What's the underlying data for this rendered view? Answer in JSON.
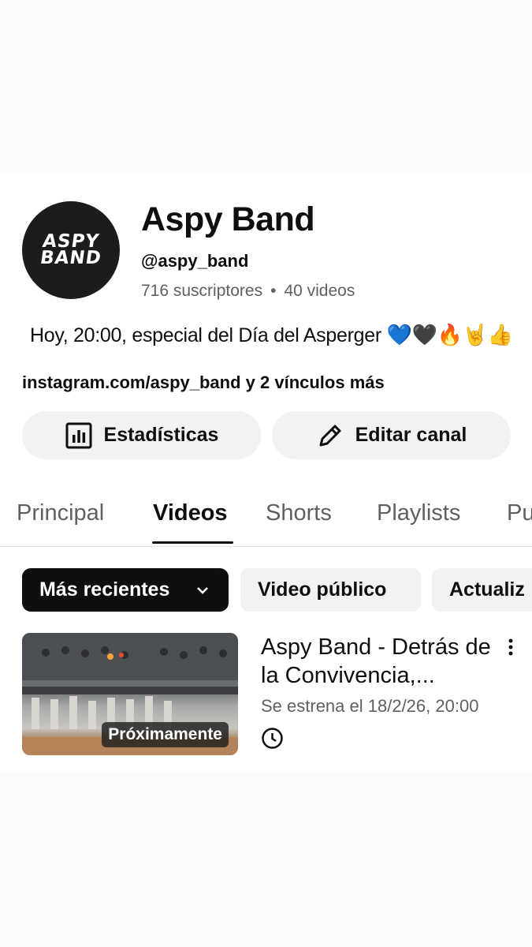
{
  "channel": {
    "avatar_text_line1": "ASPY",
    "avatar_text_line2": "BAND",
    "name": "Aspy Band",
    "handle": "@aspy_band",
    "subscribers": "716 suscriptores",
    "separator": "•",
    "video_count": "40 videos",
    "description": "Hoy, 20:00, especial del Día del Asperger",
    "description_emojis": "💙🖤🔥🤘👍",
    "links": "instagram.com/aspy_band y 2 vínculos más"
  },
  "actions": {
    "stats_label": "Estadísticas",
    "edit_label": "Editar canal"
  },
  "tabs": [
    {
      "label": "Principal"
    },
    {
      "label": "Videos"
    },
    {
      "label": "Shorts"
    },
    {
      "label": "Playlists"
    },
    {
      "label": "Pu"
    }
  ],
  "filters": {
    "sort_label": "Más recientes",
    "chip2": "Video público",
    "chip3": "Actualiz"
  },
  "video": {
    "badge": "Próximamente",
    "title": "Aspy Band - Detrás de la Convivencia,...",
    "meta": "Se estrena el 18/2/26, 20:00"
  },
  "icons": {
    "stats": "bar-chart-icon",
    "edit": "pencil-icon",
    "dropdown": "chevron-down-icon",
    "reminder": "clock-icon",
    "more": "more-vertical-icon"
  }
}
